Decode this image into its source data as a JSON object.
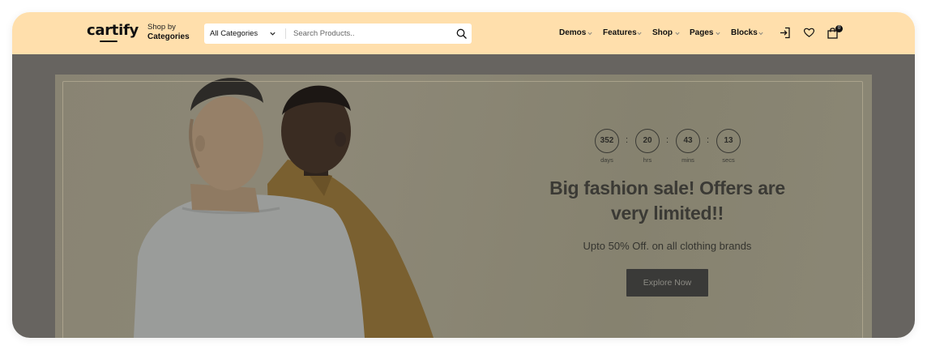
{
  "header": {
    "logo": "cartify",
    "shop_by_line1": "Shop by",
    "shop_by_line2": "Categories",
    "search": {
      "category": "All Categories",
      "placeholder": "Search Products.."
    },
    "nav": [
      {
        "label": "Demos"
      },
      {
        "label": "Features"
      },
      {
        "label": "Shop"
      },
      {
        "label": "Pages"
      },
      {
        "label": "Blocks"
      }
    ],
    "icons": [
      "login-icon",
      "heart-icon",
      "shopping-bag-icon"
    ],
    "cart_count": "0"
  },
  "hero": {
    "countdown": [
      {
        "value": "352",
        "label": "days"
      },
      {
        "value": "20",
        "label": "hrs"
      },
      {
        "value": "43",
        "label": "mins"
      },
      {
        "value": "13",
        "label": "secs"
      }
    ],
    "separator": ":",
    "title": "Big fashion sale! Offers are very limited!!",
    "subtitle": "Upto 50% Off. on all clothing brands",
    "cta": "Explore Now"
  },
  "colors": {
    "header_bg": "#ffdfac",
    "hero_overlay": "#676460",
    "cta_bg": "#3a3a38"
  }
}
